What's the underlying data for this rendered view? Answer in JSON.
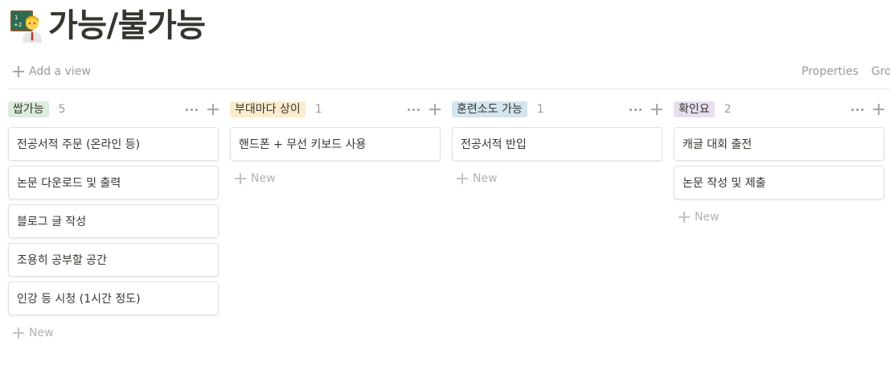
{
  "page": {
    "title": "가능/불가능",
    "icon": "teacher-at-chalkboard-icon"
  },
  "view_bar": {
    "add_view_label": "Add a view",
    "properties_label": "Properties",
    "group_label_partial": "Gro"
  },
  "colors": {
    "tag_green": "#dbeddb",
    "tag_yellow": "#fbeccd",
    "tag_blue": "#d3e5ef",
    "tag_purple": "#e8deee"
  },
  "board": {
    "columns": [
      {
        "name": "쌉가능",
        "count": "5",
        "color": "#dbeddb",
        "cards": [
          "전공서적 주문 (온라인 등)",
          "논문 다운로드 및 출력",
          "블로그 글 작성",
          "조용히 공부할 공간",
          "인강 등 시청 (1시간 정도)"
        ],
        "new_label": "New"
      },
      {
        "name": "부대마다 상이",
        "count": "1",
        "color": "#fbeccd",
        "cards": [
          "핸드폰 + 무선 키보드 사용"
        ],
        "new_label": "New"
      },
      {
        "name": "훈련소도 가능",
        "count": "1",
        "color": "#d3e5ef",
        "cards": [
          "전공서적 반입"
        ],
        "new_label": "New"
      },
      {
        "name": "확인요",
        "count": "2",
        "color": "#e8deee",
        "cards": [
          "캐글 대회 출전",
          "논문 작성 및 제출"
        ],
        "new_label": "New"
      }
    ]
  }
}
